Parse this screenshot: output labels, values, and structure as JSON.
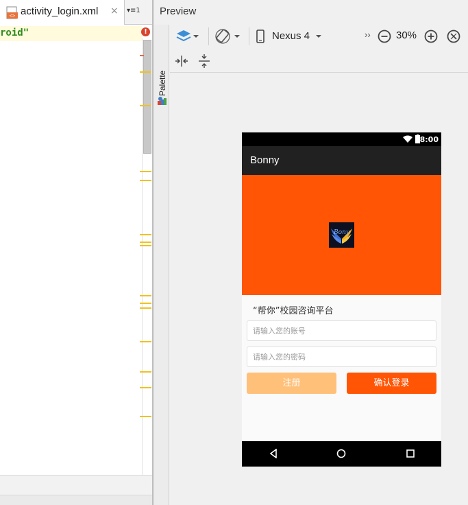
{
  "editor": {
    "tab_label": "activity_login.xml",
    "tab_close": "×",
    "tab_menu": "▾≡1",
    "code_fragment": "roid\"",
    "error_mark": "!"
  },
  "preview": {
    "title": "Preview",
    "palette_label": "Palette",
    "toolbar": {
      "device_label": "Nexus 4",
      "overflow": "››",
      "zoom_level": "30%"
    }
  },
  "device": {
    "status_time": "8:00",
    "app_title": "Bonny",
    "logo_text": "Bony",
    "subtitle": "“帮你”校园咨询平台",
    "account_placeholder": "请输入您的账号",
    "password_placeholder": "请输入您的密码",
    "register_label": "注册",
    "login_label": "确认登录"
  },
  "colors": {
    "accent_orange": "#ff5505",
    "register_orange": "#ffc07a",
    "appbar": "#212121",
    "marker_yellow": "#f0c21e"
  }
}
